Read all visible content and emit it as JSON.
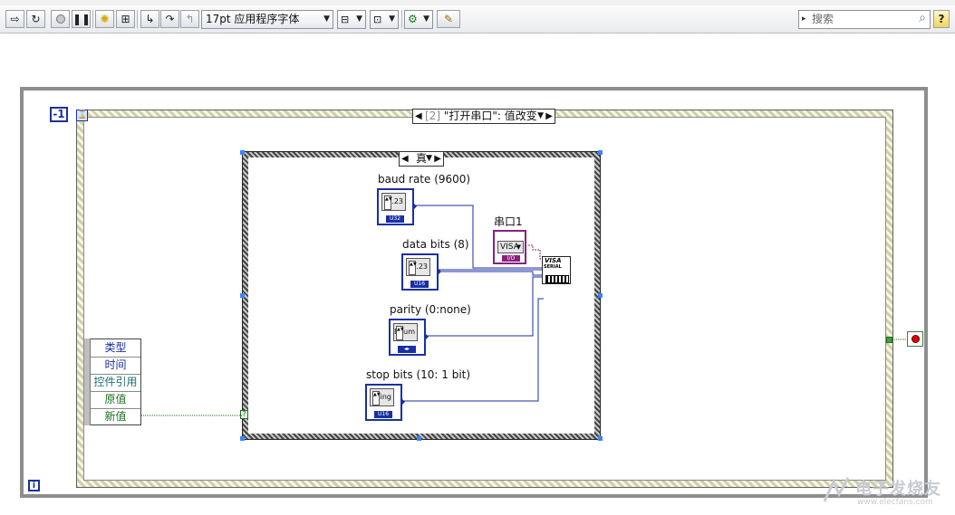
{
  "toolbar": {
    "font_select": "17pt 应用程序字体",
    "search_label": "▸",
    "search_placeholder": "搜索",
    "help_label": "?"
  },
  "block_diagram": {
    "iteration_const": "-1",
    "event_selector_index": "[2]",
    "event_selector_name": " \"打开串口\": 值改变",
    "event_data": [
      "类型",
      "时间",
      "控件引用",
      "原值",
      "新值"
    ],
    "case_selector": "真",
    "visa_resource": {
      "label": "串口1",
      "face": "VISA",
      "tag": "I/O"
    },
    "controls": [
      {
        "label": "baud rate (9600)",
        "face": "1.23",
        "tag": "U32"
      },
      {
        "label": "data bits (8)",
        "face": "1.23",
        "tag": "U16"
      },
      {
        "label": "parity (0:none)",
        "face": "Enum",
        "tag": "◂▸"
      },
      {
        "label": "stop bits (10: 1 bit)",
        "face": "Ring",
        "tag": "U16"
      }
    ],
    "visa_node": {
      "line1": "VISA",
      "line2": "SERIAL"
    },
    "loop_terminal": "i",
    "timeout_glyph": "⌛"
  },
  "watermark": {
    "brand": "电子发烧友",
    "url": "www.elecfans.com"
  }
}
